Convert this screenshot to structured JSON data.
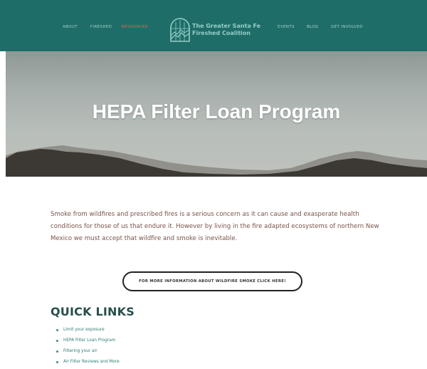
{
  "nav": {
    "left": [
      "ABOUT",
      "FIRESHED",
      "RESOURCES"
    ],
    "right": [
      "EVENTS",
      "BLOG",
      "GET INVOLVED"
    ],
    "active": "RESOURCES"
  },
  "logo": {
    "line1": "The Greater Santa Fe",
    "line2": "Fireshed Coalition"
  },
  "hero": {
    "title": "HEPA Filter Loan Program"
  },
  "intro": {
    "text": "Smoke from wildfires and prescribed fires is a serious concern as it can cause and exasperate health conditions for those of us that endure it.  However by living in the fire adapted ecosystems of northern New Mexico we must accept that wildfire and smoke is inevitable."
  },
  "cta": {
    "label": "FOR MORE INFORMATION ABOUT WILDFIRE SMOKE CLICK HERE!"
  },
  "quick_links": {
    "heading": "QUICK LINKS",
    "items": [
      "Limit your exposure",
      "HEPA Filter Loan Program",
      "Filtering your air",
      "Air Filter Reviews and More"
    ]
  },
  "colors": {
    "header_bg": "#1f6d69",
    "nav_text": "#9fd0c9",
    "nav_active": "#e0684c",
    "body_text": "#7b5248",
    "heading": "#264f4c",
    "link": "#2f7c73"
  },
  "icons": {
    "logo": "fireshed-logo-icon",
    "bullet": "bullet-icon"
  }
}
